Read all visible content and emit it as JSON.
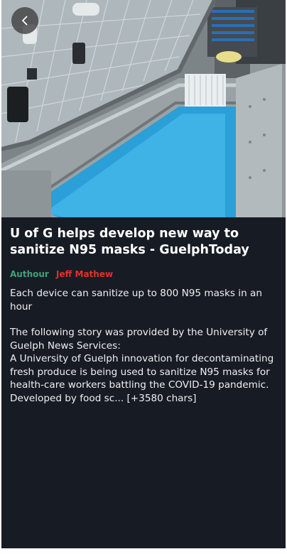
{
  "article": {
    "title": "U of G helps develop new way to sanitize N95 masks - GuelphToday",
    "author_label": "Authour",
    "author_name": "Jeff Mathew",
    "summary": "Each device can sanitize up to 800 N95 masks in an hour",
    "body_lines": [
      "The following story was provided by the University of Guelph News Services:",
      "A University of Guelph innovation for decontaminating fresh produce is being used to sanitize N95 masks for health-care workers battling the COVID-19 pandemic.",
      "Developed by food sc... [+3580 chars]"
    ]
  },
  "navigation": {
    "back_icon": "chevron-left-icon"
  },
  "colors": {
    "background": "#171c24",
    "author_label": "#3fa37a",
    "author_name": "#e0312a",
    "text": "#eef0f2"
  }
}
